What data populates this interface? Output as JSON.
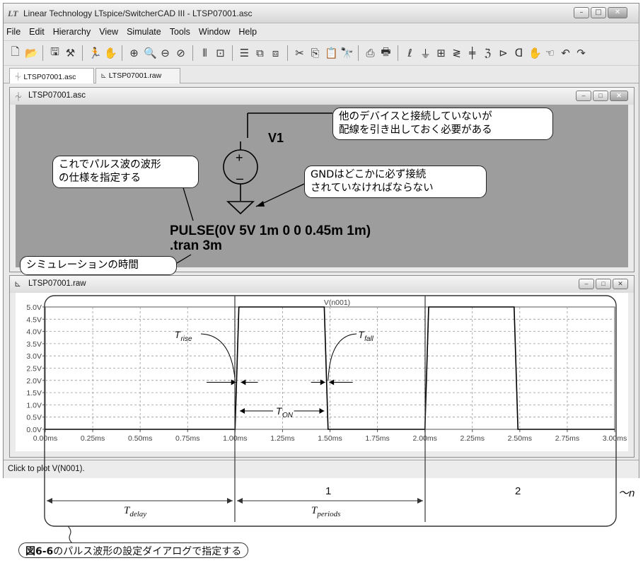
{
  "window": {
    "title": "Linear Technology LTspice/SwitcherCAD III - LTSP07001.asc",
    "logo": "LT",
    "min_label": "–",
    "max_label": "□",
    "close_label": "✕"
  },
  "menu": [
    "File",
    "Edit",
    "Hierarchy",
    "View",
    "Simulate",
    "Tools",
    "Window",
    "Help"
  ],
  "toolbar": {
    "groups": [
      [
        "new-schematic-icon",
        "open-icon"
      ],
      [
        "save-icon",
        "control-panel-icon"
      ],
      [
        "run-icon",
        "halt-icon"
      ],
      [
        "zoom-in-icon",
        "pan-icon",
        "zoom-out-icon",
        "zoom-fit-icon"
      ],
      [
        "autorange-icon",
        "plot-settings-icon"
      ],
      [
        "tile-icon",
        "cascade-icon",
        "close-window-icon"
      ],
      [
        "cut-icon",
        "copy-icon",
        "paste-icon",
        "find-icon"
      ],
      [
        "print-setup-icon",
        "print-icon"
      ],
      [
        "wire-icon",
        "ground-icon",
        "label-net-icon",
        "resistor-icon",
        "capacitor-icon",
        "inductor-icon",
        "diode-icon",
        "component-icon",
        "move-icon",
        "drag-icon",
        "undo-icon",
        "redo-icon"
      ]
    ],
    "glyphs": {
      "new-schematic-icon": "🗋",
      "open-icon": "📂",
      "save-icon": "🖫",
      "control-panel-icon": "⚒",
      "run-icon": "🏃",
      "halt-icon": "✋",
      "zoom-in-icon": "⊕",
      "pan-icon": "🔍",
      "zoom-out-icon": "⊖",
      "zoom-fit-icon": "⊘",
      "autorange-icon": "⫴",
      "plot-settings-icon": "⊡",
      "tile-icon": "☰",
      "cascade-icon": "⧉",
      "close-window-icon": "⧈",
      "cut-icon": "✂",
      "copy-icon": "⎘",
      "paste-icon": "📋",
      "find-icon": "🔭",
      "print-setup-icon": "⎙",
      "print-icon": "🖶",
      "wire-icon": "ℓ",
      "ground-icon": "⏚",
      "label-net-icon": "⊞",
      "resistor-icon": "≷",
      "capacitor-icon": "╪",
      "inductor-icon": "ℨ",
      "diode-icon": "⊳",
      "component-icon": "ᗡ",
      "move-icon": "✋",
      "drag-icon": "☜",
      "undo-icon": "↶",
      "redo-icon": "↷"
    }
  },
  "tabs": [
    {
      "label": "LTSP07001.asc",
      "icon": "schematic-icon"
    },
    {
      "label": "LTSP07001.raw",
      "icon": "waveform-icon"
    }
  ],
  "schematic": {
    "title": "LTSP07001.asc",
    "component_name": "V1",
    "directive_pulse": "PULSE(0V 5V 1m 0 0 0.45m 1m)",
    "directive_tran": ".tran 3m",
    "notes": {
      "wire": [
        "他のデバイスと接続していないが",
        "配線を引き出しておく必要がある"
      ],
      "pulse": [
        "これでパルス波の波形",
        "の仕様を指定する"
      ],
      "gnd": [
        "GNDはどこかに必ず接続",
        "されていなければならない"
      ],
      "tran": "シミュレーションの時間"
    }
  },
  "plot": {
    "title": "LTSP07001.raw",
    "trace_name": "V(n001)",
    "y_ticks": [
      "5.0V",
      "4.5V",
      "4.0V",
      "3.5V",
      "3.0V",
      "2.5V",
      "2.0V",
      "1.5V",
      "1.0V",
      "0.5V",
      "0.0V"
    ],
    "x_ticks": [
      "0.00ms",
      "0.25ms",
      "0.50ms",
      "0.75ms",
      "1.00ms",
      "1.25ms",
      "1.50ms",
      "1.75ms",
      "2.00ms",
      "2.25ms",
      "2.50ms",
      "2.75ms",
      "3.00ms"
    ],
    "annotations": {
      "rise": "T",
      "rise_sub": "rise",
      "fall": "T",
      "fall_sub": "fall",
      "on": "T",
      "on_sub": "ON"
    }
  },
  "chart_data": {
    "type": "line",
    "title": "V(n001)",
    "xlabel": "",
    "ylabel": "",
    "x_unit": "ms",
    "y_unit": "V",
    "xlim": [
      0,
      3
    ],
    "ylim": [
      0,
      5
    ],
    "grid": true,
    "series": [
      {
        "name": "V(n001)",
        "points": [
          [
            0,
            0
          ],
          [
            1.0,
            0
          ],
          [
            1.02,
            5
          ],
          [
            1.47,
            5
          ],
          [
            1.49,
            0
          ],
          [
            2.0,
            0
          ],
          [
            2.02,
            5
          ],
          [
            2.47,
            5
          ],
          [
            2.49,
            0
          ],
          [
            3.0,
            0
          ]
        ]
      }
    ]
  },
  "status": {
    "text": "Click to plot V(N001)."
  },
  "timing": {
    "period_1": "1",
    "period_2": "2",
    "period_n": "～n",
    "t_delay": "T",
    "t_delay_sub": "delay",
    "t_periods": "T",
    "t_periods_sub": "periods",
    "caption_bold": "図6-6",
    "caption_rest": "のパルス波形の設定ダイアログで指定する"
  }
}
